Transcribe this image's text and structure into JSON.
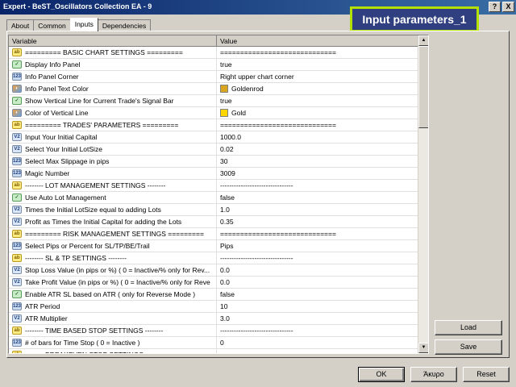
{
  "window": {
    "title": "Expert - BeST_Oscillators Collection EA - 9",
    "help_label": "?",
    "close_label": "X"
  },
  "badge": "Input parameters_1",
  "tabs": [
    "About",
    "Common",
    "Inputs",
    "Dependencies"
  ],
  "active_tab": "Inputs",
  "grid": {
    "header_variable": "Variable",
    "header_value": "Value",
    "rows": [
      {
        "icon": "ab",
        "variable": "========= BASIC CHART SETTINGS =========",
        "value": "============================="
      },
      {
        "icon": "bool",
        "variable": "Display Info Panel",
        "value": "true"
      },
      {
        "icon": "123",
        "variable": "Info Panel Corner",
        "value": "Right upper chart corner"
      },
      {
        "icon": "color",
        "variable": "Info Panel Text Color",
        "value": "Goldenrod",
        "swatch": "#daa520"
      },
      {
        "icon": "bool",
        "variable": "Show Vertical Line for Current Trade's Signal Bar",
        "value": "true"
      },
      {
        "icon": "color",
        "variable": "Color of Vertical Line",
        "value": "Gold",
        "swatch": "#ffd700"
      },
      {
        "icon": "ab",
        "variable": "========= TRADES' PARAMETERS =========",
        "value": "============================="
      },
      {
        "icon": "v2",
        "variable": "Input Your Initial Capital",
        "value": "1000.0"
      },
      {
        "icon": "v2",
        "variable": "Select Your Initial LotSize",
        "value": "0.02"
      },
      {
        "icon": "123",
        "variable": "Select Max Slippage in pips",
        "value": "30"
      },
      {
        "icon": "123",
        "variable": "Magic Number",
        "value": "3009"
      },
      {
        "icon": "ab",
        "variable": "-------- LOT MANAGEMENT SETTINGS --------",
        "value": "--------------------------------"
      },
      {
        "icon": "bool",
        "variable": "Use Auto Lot Management",
        "value": "false"
      },
      {
        "icon": "v2",
        "variable": "Times the Initial LotSize equal to adding Lots",
        "value": "1.0"
      },
      {
        "icon": "v2",
        "variable": "Profit as Times the Initial Capital for adding the Lots",
        "value": "0.35"
      },
      {
        "icon": "ab",
        "variable": "========= RISK MANAGEMENT SETTINGS =========",
        "value": "============================="
      },
      {
        "icon": "123",
        "variable": "Select Pips or Percent for SL/TP/BE/Trail",
        "value": "Pips"
      },
      {
        "icon": "ab",
        "variable": "-------- SL & TP  SETTINGS --------",
        "value": "--------------------------------"
      },
      {
        "icon": "v2",
        "variable": "Stop Loss Value (in pips or %) ( 0 = Inactive/% only for Rev...",
        "value": "0.0"
      },
      {
        "icon": "v2",
        "variable": "Take Profit Value (in pips or %) ( 0 = Inactive/% only for Reve",
        "value": "0.0"
      },
      {
        "icon": "bool",
        "variable": "Enable ATR SL based on ATR ( only for Reverse Mode )",
        "value": "false"
      },
      {
        "icon": "123",
        "variable": "ATR Period",
        "value": "10"
      },
      {
        "icon": "v2",
        "variable": "ATR Multiplier",
        "value": "3.0"
      },
      {
        "icon": "ab",
        "variable": "-------- TIME BASED STOP SETTINGS --------",
        "value": "--------------------------------"
      },
      {
        "icon": "123",
        "variable": "# of bars for Time Stop ( 0 = Inactive )",
        "value": "0"
      },
      {
        "icon": "ab",
        "variable": "-------- BREAKEVEN STOP SETTINGS --------",
        "value": ""
      }
    ]
  },
  "buttons": {
    "load": "Load",
    "save": "Save",
    "ok": "OK",
    "cancel": "Άκυρο",
    "reset": "Reset"
  }
}
